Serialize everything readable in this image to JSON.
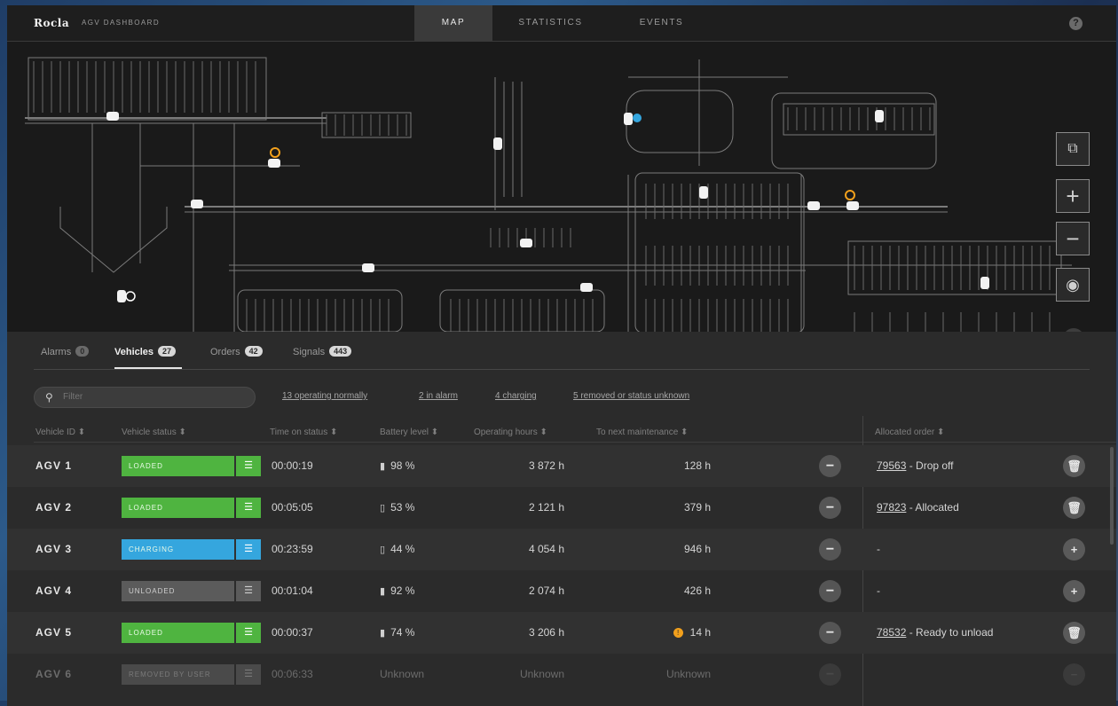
{
  "app": {
    "brand": "Rocla",
    "subtitle": "AGV DASHBOARD",
    "tabs": [
      {
        "label": "MAP",
        "active": true
      },
      {
        "label": "STATISTICS",
        "active": false
      },
      {
        "label": "EVENTS",
        "active": false
      }
    ],
    "help_label": "?"
  },
  "map_controls": {
    "fit_icon": "fit-view-icon",
    "zoom_in": "+",
    "zoom_out": "−",
    "center_icon": "target-icon",
    "collapse": "⌄"
  },
  "panel": {
    "tabs": [
      {
        "label": "Alarms",
        "count": "0"
      },
      {
        "label": "Vehicles",
        "count": "27"
      },
      {
        "label": "Orders",
        "count": "42"
      },
      {
        "label": "Signals",
        "count": "443"
      }
    ],
    "filter_placeholder": "Filter",
    "filter_links": [
      "13 operating normally",
      "2 in alarm",
      "4 charging",
      "5 removed or status unknown"
    ],
    "columns": {
      "vehicle_id": "Vehicle ID ⬍",
      "vehicle_status": "Vehicle status ⬍",
      "time_on_status": "Time on status ⬍",
      "battery_level": "Battery level ⬍",
      "operating_hours": "Operating hours ⬍",
      "to_next_maintenance": "To next maintenance ⬍",
      "allocated_order": "Allocated order ⬍"
    },
    "rows": [
      {
        "id": "AGV 1",
        "status": "LOADED",
        "time": "00:00:19",
        "battery": "98 %",
        "hours": "3 872 h",
        "maint": "128 h",
        "order_id": "79563",
        "order_text": " - Drop off",
        "action": "🗑"
      },
      {
        "id": "AGV 2",
        "status": "LOADED",
        "time": "00:05:05",
        "battery": "53 %",
        "hours": "2 121 h",
        "maint": "379 h",
        "order_id": "97823",
        "order_text": " - Allocated",
        "action": "🗑"
      },
      {
        "id": "AGV 3",
        "status": "CHARGING",
        "time": "00:23:59",
        "battery": "44 %",
        "hours": "4 054 h",
        "maint": "946 h",
        "order_id": "",
        "order_text": "-",
        "action": "+"
      },
      {
        "id": "AGV 4",
        "status": "UNLOADED",
        "time": "00:01:04",
        "battery": "92 %",
        "hours": "2 074 h",
        "maint": "426 h",
        "order_id": "",
        "order_text": "-",
        "action": "+"
      },
      {
        "id": "AGV 5",
        "status": "LOADED",
        "time": "00:00:37",
        "battery": "74 %",
        "hours": "3 206 h",
        "maint": "14 h",
        "order_id": "78532",
        "order_text": " - Ready to unload",
        "action": "🗑"
      },
      {
        "id": "AGV 6",
        "status": "REMOVED BY USER",
        "time": "00:06:33",
        "battery": "Unknown",
        "hours": "Unknown",
        "maint": "Unknown",
        "order_id": "",
        "order_text": "",
        "action": "−"
      }
    ]
  },
  "colors": {
    "loaded": "#4fb440",
    "charging": "#35a6de",
    "unloaded": "#5b5b5b",
    "warning": "#f2a01c"
  }
}
